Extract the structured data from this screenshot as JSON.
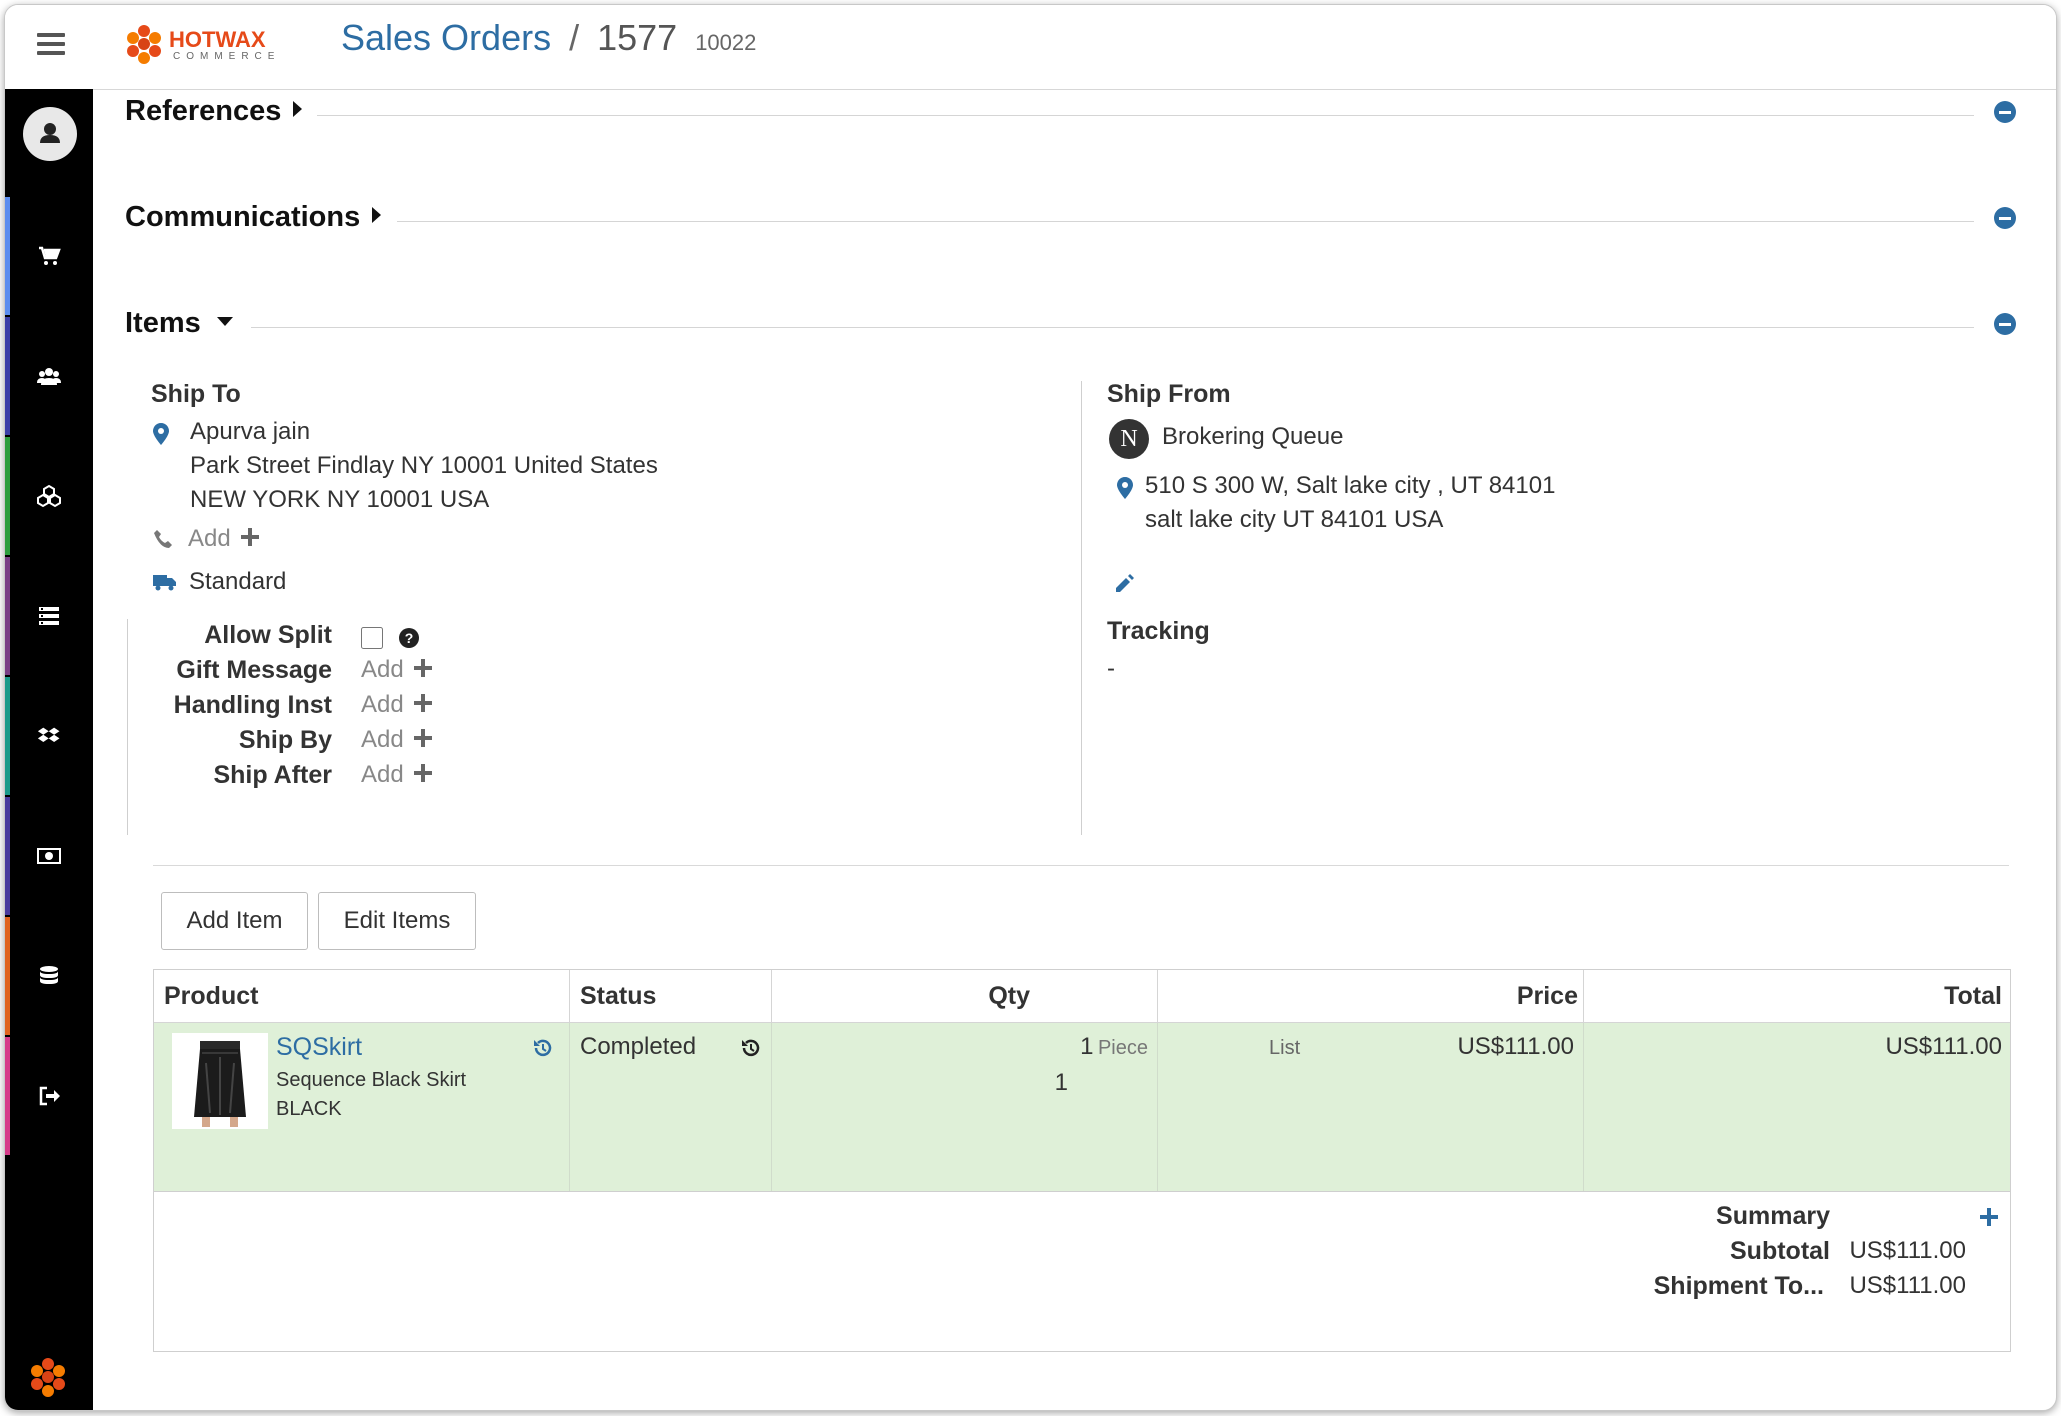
{
  "header": {
    "brand_name": "HOTWAX",
    "brand_sub": "COMMERCE",
    "breadcrumb_link": "Sales Orders",
    "breadcrumb_sep": "/",
    "order_id": "1577",
    "order_ref": "10022"
  },
  "sidebar": {
    "items": [
      {
        "icon": "cart-icon",
        "color": "#5b8def"
      },
      {
        "icon": "users-icon",
        "color": "#3c3fa8"
      },
      {
        "icon": "cubes-icon",
        "color": "#2e9e3e"
      },
      {
        "icon": "list-icon",
        "color": "#7a3f86"
      },
      {
        "icon": "dropbox-icon",
        "color": "#1a9a8a"
      },
      {
        "icon": "money-icon",
        "color": "#4a3c9e"
      },
      {
        "icon": "database-icon",
        "color": "#e0641f"
      },
      {
        "icon": "sign-out-icon",
        "color": "#d63c8a"
      }
    ]
  },
  "sections": {
    "references": "References",
    "communications": "Communications",
    "items": "Items"
  },
  "ship_to": {
    "heading": "Ship To",
    "name": "Apurva jain",
    "address_line1": "Park Street Findlay NY 10001 United States",
    "address_line2": "NEW YORK NY 10001 USA",
    "phone_add": "Add",
    "shipping_method": "Standard"
  },
  "options": {
    "allow_split": "Allow Split",
    "allow_split_checked": false,
    "gift_message": "Gift Message",
    "handling_inst": "Handling Inst",
    "ship_by": "Ship By",
    "ship_after": "Ship After",
    "add_label": "Add"
  },
  "ship_from": {
    "heading": "Ship From",
    "badge": "N",
    "facility": "Brokering Queue",
    "address_line1": "510 S 300 W, Salt lake city , UT 84101",
    "address_line2": "salt lake city UT 84101 USA",
    "tracking_heading": "Tracking",
    "tracking_value": "-"
  },
  "item_buttons": {
    "add_item": "Add Item",
    "edit_items": "Edit Items"
  },
  "table": {
    "columns": [
      "Product",
      "Status",
      "Qty",
      "Price",
      "Total"
    ],
    "rows": [
      {
        "product_id": "SQSkirt",
        "product_name": "Sequence Black Skirt",
        "color": "BLACK",
        "status": "Completed",
        "qty": "1",
        "qty_unit": "Piece",
        "qty_second": "1",
        "price_type": "List",
        "price": "US$111.00",
        "total": "US$111.00"
      }
    ]
  },
  "summary": {
    "heading": "Summary",
    "subtotal_label": "Subtotal",
    "subtotal_value": "US$111.00",
    "shipment_label": "Shipment To...",
    "shipment_value": "US$111.00"
  },
  "colors": {
    "link_blue": "#2d6da3",
    "row_green": "#dff0d8",
    "sidebar_bg": "#000000"
  }
}
